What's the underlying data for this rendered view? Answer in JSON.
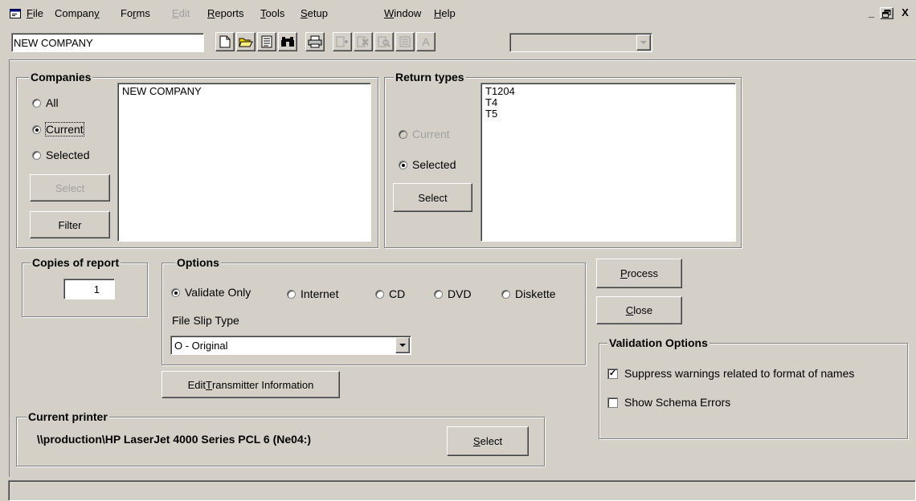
{
  "menubar": {
    "items": [
      {
        "pre": "",
        "u": "F",
        "post": "ile",
        "disabled": false
      },
      {
        "pre": "Compan",
        "u": "y",
        "post": "",
        "disabled": false
      },
      {
        "pre": "Fo",
        "u": "r",
        "post": "ms",
        "disabled": false
      },
      {
        "pre": "",
        "u": "E",
        "post": "dit",
        "disabled": true
      },
      {
        "pre": "",
        "u": "R",
        "post": "eports",
        "disabled": false
      },
      {
        "pre": "",
        "u": "T",
        "post": "ools",
        "disabled": false
      },
      {
        "pre": "",
        "u": "S",
        "post": "etup",
        "disabled": false
      },
      {
        "pre": "",
        "u": "W",
        "post": "indow",
        "disabled": false
      },
      {
        "pre": "",
        "u": "H",
        "post": "elp",
        "disabled": false
      }
    ],
    "window_buttons": {
      "minimize": "_",
      "restore": "🗗",
      "close": "X"
    }
  },
  "toolbar": {
    "company_value": "NEW COMPANY",
    "combo_value": ""
  },
  "companies": {
    "label": "Companies",
    "radios": {
      "all": "All",
      "current": "Current",
      "selected": "Selected"
    },
    "selected_radio": "current",
    "select_button": "Select",
    "filter_button": "Filter",
    "list": [
      "NEW COMPANY"
    ]
  },
  "return_types": {
    "label": "Return types",
    "radios": {
      "current": "Current",
      "selected": "Selected"
    },
    "selected_radio": "selected",
    "select_button": "Select",
    "list": [
      "T1204",
      "T4",
      "T5"
    ]
  },
  "copies": {
    "label": "Copies of report",
    "value": "1"
  },
  "options": {
    "label": "Options",
    "radios": {
      "validate": "Validate Only",
      "internet": "Internet",
      "cd": "CD",
      "dvd": "DVD",
      "diskette": "Diskette"
    },
    "selected_radio": "validate",
    "file_slip_label": "File Slip Type",
    "file_slip_value": "O - Original"
  },
  "edit_transmitter": {
    "pre": "Edit ",
    "u": "T",
    "post": "ransmitter Information"
  },
  "process_button": {
    "u": "P",
    "post": "rocess"
  },
  "close_button": {
    "u": "C",
    "post": "lose"
  },
  "validation": {
    "label": "Validation Options",
    "suppress": {
      "text": "Suppress warnings related to format of names",
      "checked": true
    },
    "schema": {
      "text": "Show Schema Errors",
      "checked": false
    }
  },
  "printer": {
    "label": "Current printer",
    "name": "\\\\production\\HP LaserJet 4000 Series PCL 6 (Ne04:)",
    "select": {
      "u": "S",
      "post": "elect"
    }
  },
  "status_bar": {
    "text": ""
  }
}
